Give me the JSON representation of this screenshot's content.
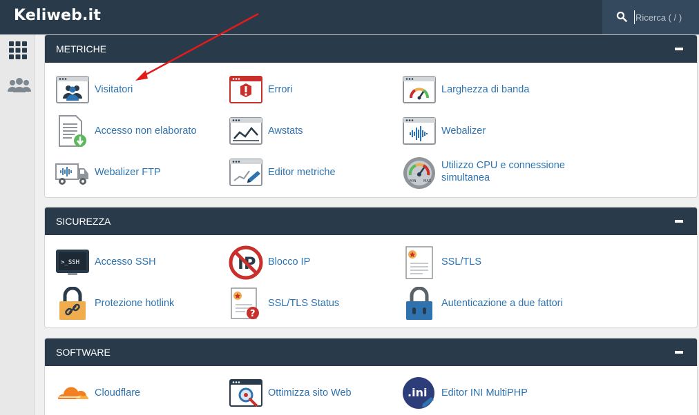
{
  "brand": "Keliweb.it",
  "search": {
    "placeholder": "Ricerca ( / )",
    "icon": "search-icon"
  },
  "sidebar": {
    "icons": [
      "apps-grid-icon",
      "users-icon"
    ]
  },
  "colors": {
    "header": "#293a4a",
    "link": "#2e73b0",
    "annotation": "#e21b1b"
  },
  "sections": [
    {
      "title": "METRICHE",
      "items": [
        {
          "label": "Visitatori",
          "icon": "visitors-icon"
        },
        {
          "label": "Errori",
          "icon": "errors-icon"
        },
        {
          "label": "Larghezza di banda",
          "icon": "bandwidth-gauge-icon"
        },
        {
          "label": "Accesso non elaborato",
          "icon": "raw-access-icon"
        },
        {
          "label": "Awstats",
          "icon": "awstats-chart-icon"
        },
        {
          "label": "Webalizer",
          "icon": "webalizer-icon"
        },
        {
          "label": "Webalizer FTP",
          "icon": "webalizer-ftp-truck-icon"
        },
        {
          "label": "Editor metriche",
          "icon": "metrics-editor-icon"
        },
        {
          "label": "Utilizzo CPU e connessione simultanea",
          "icon": "cpu-gauge-icon"
        }
      ]
    },
    {
      "title": "SICUREZZA",
      "items": [
        {
          "label": "Accesso SSH",
          "icon": "ssh-terminal-icon"
        },
        {
          "label": "Blocco IP",
          "icon": "ip-block-icon"
        },
        {
          "label": "SSL/TLS",
          "icon": "certificate-icon"
        },
        {
          "label": "Protezione hotlink",
          "icon": "hotlink-lock-icon"
        },
        {
          "label": "SSL/TLS Status",
          "icon": "certificate-status-icon"
        },
        {
          "label": "Autenticazione a due fattori",
          "icon": "two-factor-lock-icon"
        }
      ]
    },
    {
      "title": "SOFTWARE",
      "items": [
        {
          "label": "Cloudflare",
          "icon": "cloudflare-icon"
        },
        {
          "label": "Ottimizza sito Web",
          "icon": "optimize-website-icon"
        },
        {
          "label": "Editor INI MultiPHP",
          "icon": "ini-editor-icon"
        }
      ]
    }
  ]
}
